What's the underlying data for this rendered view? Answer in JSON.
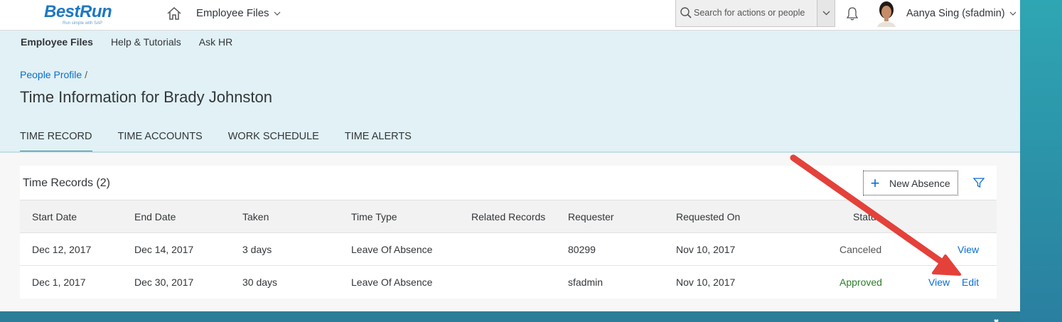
{
  "shell": {
    "brand": "BestRun",
    "tagline": "Run simple with SAP",
    "module_menu": "Employee Files",
    "search_placeholder": "Search for actions or people",
    "user_name": "Aanya Sing (sfadmin)"
  },
  "subnav": {
    "items": [
      "Employee Files",
      "Help & Tutorials",
      "Ask HR"
    ]
  },
  "breadcrumb": {
    "link": "People Profile",
    "separator": "/"
  },
  "page_title": "Time Information for Brady Johnston",
  "tabs": [
    "TIME RECORD",
    "TIME ACCOUNTS",
    "WORK SCHEDULE",
    "TIME ALERTS"
  ],
  "time_records": {
    "title": "Time Records (2)",
    "new_button": "New Absence",
    "columns": [
      "Start Date",
      "End Date",
      "Taken",
      "Time Type",
      "Related Records",
      "Requester",
      "Requested On",
      "Status"
    ],
    "rows": [
      {
        "start": "Dec 12, 2017",
        "end": "Dec 14, 2017",
        "taken": "3 days",
        "type": "Leave Of Absence",
        "related": "",
        "requester": "80299",
        "requested_on": "Nov 10, 2017",
        "status": "Canceled",
        "action1": "View"
      },
      {
        "start": "Dec 1, 2017",
        "end": "Dec 30, 2017",
        "taken": "30 days",
        "type": "Leave Of Absence",
        "related": "",
        "requester": "sfadmin",
        "requested_on": "Nov 10, 2017",
        "status": "Approved",
        "action1": "View",
        "action2": "Edit"
      }
    ]
  },
  "colors": {
    "accent": "#0a6ed1",
    "header_band": "#e1f1f5",
    "approved": "#2b7d2b",
    "annotation_arrow": "#e4413a"
  },
  "icons": [
    "home-icon",
    "chevron-down-icon",
    "search-icon",
    "bell-icon",
    "avatar",
    "plus-icon",
    "filter-icon"
  ]
}
